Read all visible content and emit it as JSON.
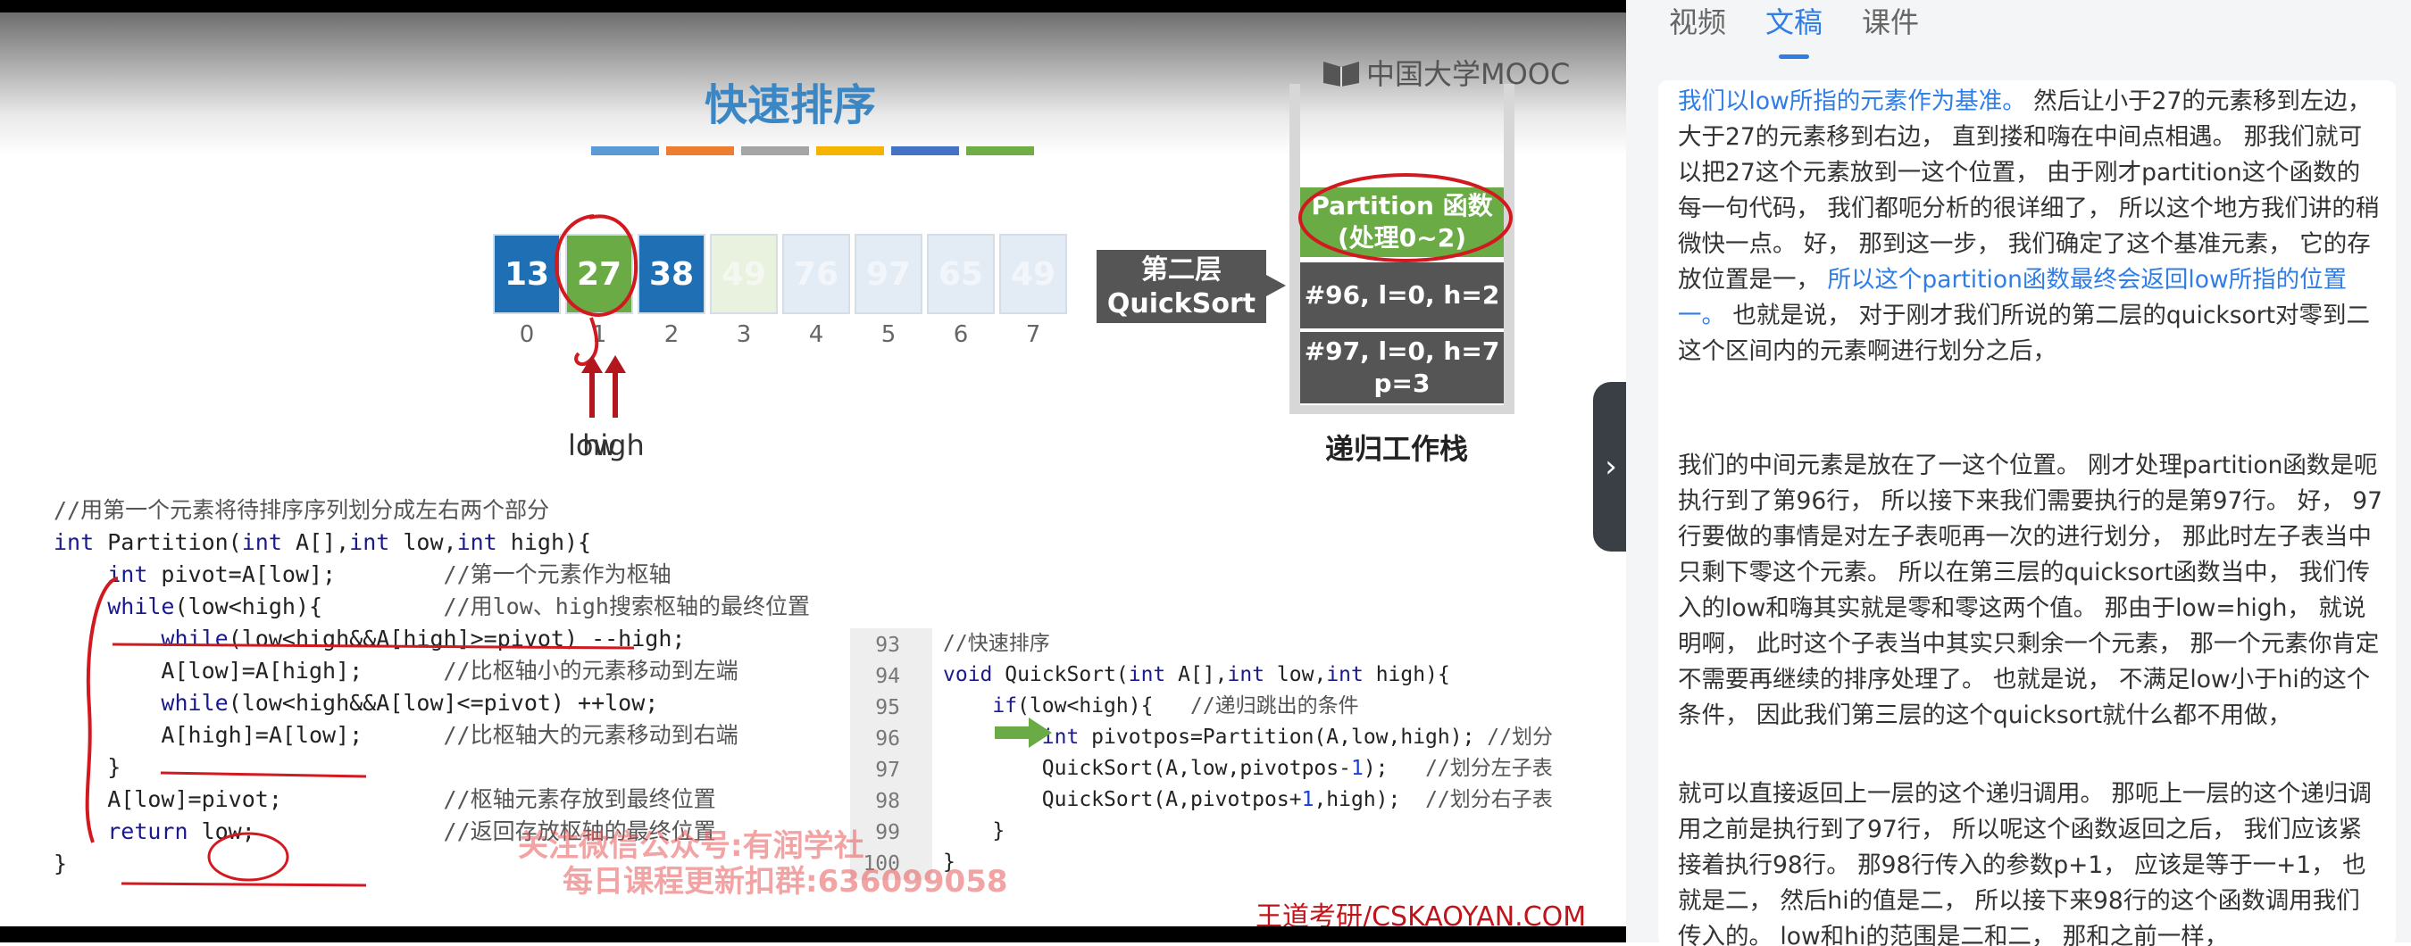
{
  "slide": {
    "title": "快速排序",
    "mooc_brand": "中国大学MOOC",
    "stripe_colors": [
      "#5b9bd5",
      "#ed7d31",
      "#a5a5a5",
      "#f4b400",
      "#4472c4",
      "#70ad47"
    ],
    "array": {
      "cells": [
        {
          "value": "13",
          "state": "done"
        },
        {
          "value": "27",
          "state": "pivot"
        },
        {
          "value": "38",
          "state": "done"
        },
        {
          "value": "49",
          "state": "faded-green"
        },
        {
          "value": "76",
          "state": "faded"
        },
        {
          "value": "97",
          "state": "faded"
        },
        {
          "value": "65",
          "state": "faded"
        },
        {
          "value": "49",
          "state": "faded"
        }
      ],
      "indices": [
        "0",
        "1",
        "2",
        "3",
        "4",
        "5",
        "6",
        "7"
      ]
    },
    "pointer_low": "low",
    "pointer_high": "high",
    "layer_label_line1": "第二层",
    "layer_label_line2": "QuickSort",
    "stack": {
      "frames": [
        {
          "line1": "Partition 函数",
          "line2": "(处理0~2)",
          "color": "#6aab46"
        },
        {
          "line1": "#96, l=0, h=2",
          "line2": "",
          "color": "#555555"
        },
        {
          "line1": "#97, l=0, h=7",
          "line2": "p=3",
          "color": "#555555"
        }
      ],
      "label": "递归工作栈"
    },
    "partition_code": [
      "//用第一个元素将待排序序列划分成左右两个部分",
      "int Partition(int A[],int low,int high){",
      "    int pivot=A[low];        //第一个元素作为枢轴",
      "    while(low<high){         //用low、high搜索枢轴的最终位置",
      "        while(low<high&&A[high]>=pivot) --high;",
      "        A[low]=A[high];      //比枢轴小的元素移动到左端",
      "        while(low<high&&A[low]<=pivot) ++low;",
      "        A[high]=A[low];      //比枢轴大的元素移动到右端",
      "    }",
      "    A[low]=pivot;            //枢轴元素存放到最终位置",
      "    return low;              //返回存放枢轴的最终位置",
      "}"
    ],
    "quicksort_lines": [
      "93",
      "94",
      "95",
      "96",
      "97",
      "98",
      "99",
      "100"
    ],
    "quicksort_code": [
      "//快速排序",
      "void QuickSort(int A[],int low,int high){",
      "    if(low<high){   //递归跳出的条件",
      "        int pivotpos=Partition(A,low,high); //划分",
      "        QuickSort(A,low,pivotpos-1);   //划分左子表",
      "        QuickSort(A,pivotpos+1,high);  //划分右子表",
      "    }",
      "}"
    ],
    "watermark_line1": "关注微信公众号:有润学社",
    "watermark_line2": "每日课程更新扣群:636099058",
    "footer_brand": "王道考研/CSKAOYAN.COM"
  },
  "panel": {
    "tabs": [
      {
        "label": "视频",
        "active": false
      },
      {
        "label": "文稿",
        "active": true
      },
      {
        "label": "课件",
        "active": false
      }
    ],
    "collapse_glyph": "›",
    "paragraphs": [
      [
        {
          "text": "我们以low所指的元素作为基准。",
          "hl": true
        },
        {
          "text": " 然后让小于27的元素移到左边， 大于27的元素移到右边， 直到搂和嗨在中间点相遇。 那我们就可以把27这个元素放到一这个位置， 由于刚才partition这个函数的每一句代码， 我们都呃分析的很详细了， 所以这个地方我们讲的稍微快一点。 好， 那到这一步， 我们确定了这个基准元素， 它的存放位置是一， ",
          "hl": false
        },
        {
          "text": "所以这个partition函数最终会返回low所指的位置一。",
          "hl": true
        },
        {
          "text": " 也就是说， 对于刚才我们所说的第二层的quicksort对零到二这个区间内的元素啊进行划分之后，",
          "hl": false
        }
      ],
      [
        {
          "text": "我们的中间元素是放在了一这个位置。 刚才处理partition函数是呃执行到了第96行， 所以接下来我们需要执行的是第97行。 好， 97行要做的事情是对左子表呃再一次的进行划分， 那此时左子表当中只剩下零这个元素。 所以在第三层的quicksort函数当中， 我们传入的low和嗨其实就是零和零这两个值。 那由于low=high， 就说明啊， 此时这个子表当中其实只剩余一个元素， 那一个元素你肯定不需要再继续的排序处理了。 也就是说， 不满足low小于hi的这个条件， 因此我们第三层的这个quicksort就什么都不用做，",
          "hl": false
        }
      ],
      [
        {
          "text": "就可以直接返回上一层的这个递归调用。 那呃上一层的这个递归调用之前是执行到了97行， 所以呢这个函数返回之后， 我们应该紧接着执行98行。 那98行传入的参数p+1， 应该是等于一+1， 也就是二， 然后hi的值是二， 所以接下来98行的这个函数调用我们传入的。 low和hi的范围是二和二， 那和之前一样，",
          "hl": false
        }
      ]
    ]
  }
}
